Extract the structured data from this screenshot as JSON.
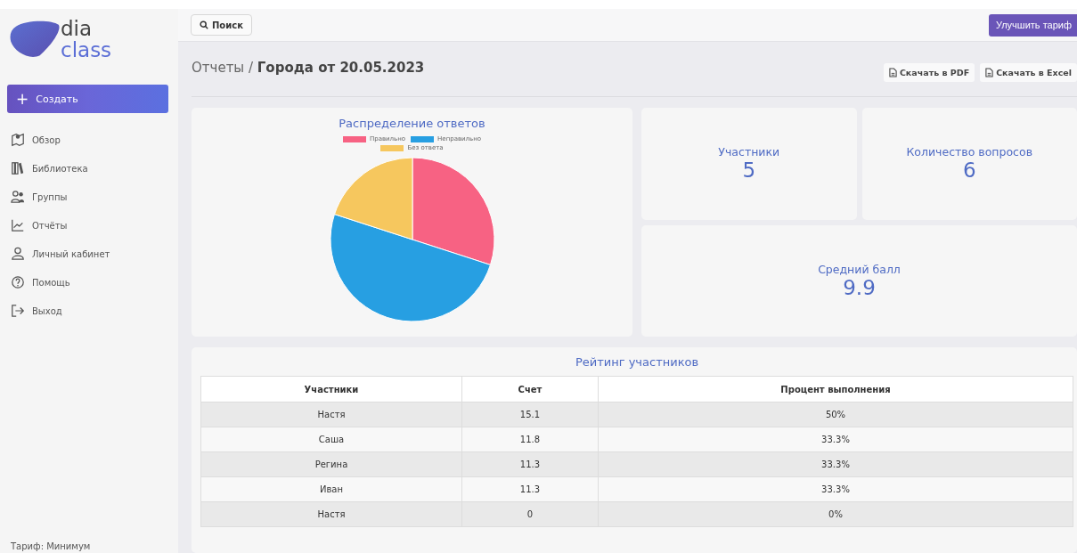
{
  "sidebar": {
    "logo": {
      "line_1": "dia",
      "line_2": "class"
    },
    "create_button": {
      "icon": "+",
      "label": "Создать"
    },
    "items": [
      {
        "kind": "overview",
        "label": "Обзор"
      },
      {
        "kind": "library",
        "label": "Библиотека"
      },
      {
        "kind": "groups",
        "label": "Группы"
      },
      {
        "kind": "reports",
        "label": "Отчёты"
      },
      {
        "kind": "account",
        "label": "Личный кабинет"
      },
      {
        "kind": "help",
        "label": "Помощь"
      },
      {
        "kind": "logout",
        "label": "Выход"
      }
    ],
    "plan": "Тариф: Минимум"
  },
  "topbar": {
    "search_button": "Поиск",
    "upgrade_button": "Улучшить тариф"
  },
  "header": {
    "breadcrumb": "Отчеты / ",
    "title": "Города от 20.05.2023",
    "buttons": [
      "Скачать в PDF",
      "Скачать в Excel"
    ]
  },
  "pie_card": {
    "chart_data": {
      "type": "pie",
      "title": "Распределение ответов",
      "categories": [
        "Правильно",
        "Неправильно",
        "Без ответа"
      ],
      "values": [
        30,
        50,
        20
      ],
      "colors": [
        "#f76283",
        "#279fe2",
        "#f6c75e"
      ]
    }
  },
  "stats": [
    {
      "label": "Участники",
      "value": "5"
    },
    {
      "label": "Количество вопросов",
      "value": "6"
    },
    {
      "label": "Средний балл",
      "value": "9.9"
    }
  ],
  "rating": {
    "title": "Рейтинг участников",
    "columns": [
      "Участники",
      "Счет",
      "Процент выполнения"
    ],
    "rows": [
      [
        "Настя",
        "15.1",
        "50%"
      ],
      [
        "Саша",
        "11.8",
        "33.3%"
      ],
      [
        "Регина",
        "11.3",
        "33.3%"
      ],
      [
        "Иван",
        "11.3",
        "33.3%"
      ],
      [
        "Настя",
        "0",
        "0%"
      ]
    ]
  }
}
